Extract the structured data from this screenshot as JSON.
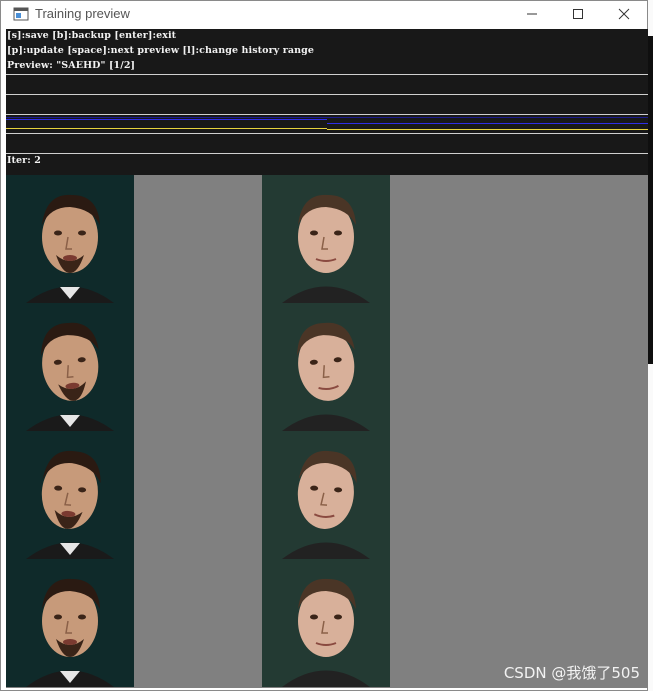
{
  "window": {
    "title": "Training preview",
    "icon": "app-window-icon",
    "controls": [
      "minimize-icon",
      "maximize-icon",
      "close-icon"
    ]
  },
  "help": {
    "line1": "[s]:save [b]:backup [enter]:exit",
    "line2": "[p]:update [space]:next preview [l]:change history range",
    "line3": "Preview: \"SAEHD\" [1/2]"
  },
  "status": {
    "iter": "Iter: 2"
  },
  "graph_colors": {
    "dark_blue": "#1a1a8c",
    "blue": "#2e2ee6",
    "yellow": "#e6d23c"
  },
  "preview": {
    "rows": [
      {
        "src": "face-source-1",
        "dst": "face-destination-1"
      },
      {
        "src": "face-source-2",
        "dst": "face-destination-2"
      },
      {
        "src": "face-source-3",
        "dst": "face-destination-3"
      },
      {
        "src": "face-source-4",
        "dst": "face-destination-4"
      }
    ]
  },
  "watermark": "CSDN @我饿了505"
}
